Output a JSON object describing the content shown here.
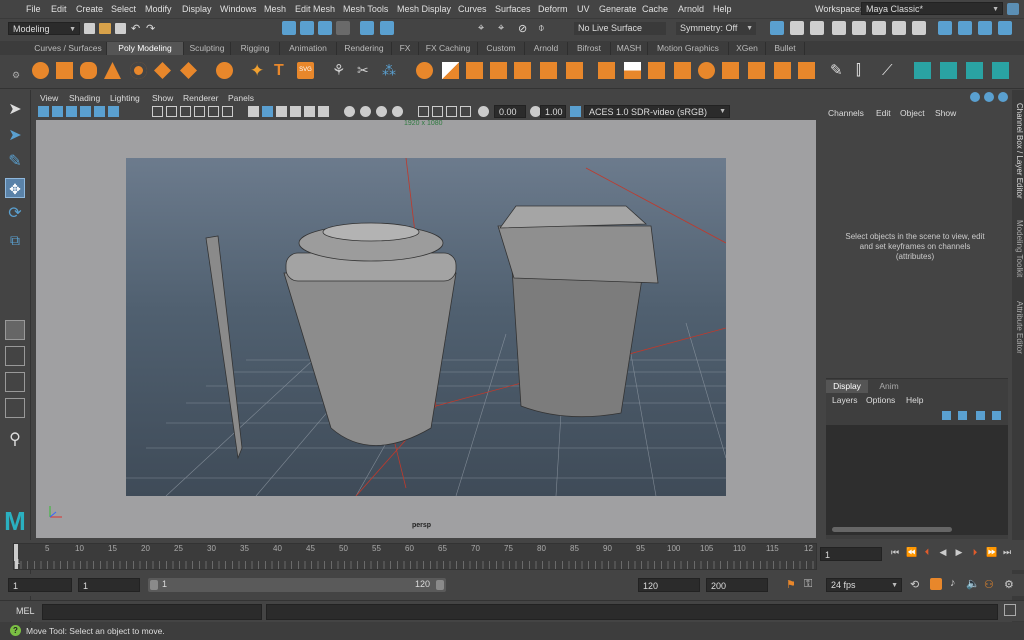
{
  "menubar": {
    "items": [
      "File",
      "Edit",
      "Create",
      "Select",
      "Modify",
      "Display",
      "Windows",
      "Mesh",
      "Edit Mesh",
      "Mesh Tools",
      "Mesh Display",
      "Curves",
      "Surfaces",
      "Deform",
      "UV",
      "Generate",
      "Cache",
      "Arnold",
      "Help"
    ],
    "workspace_label": "Workspace:",
    "workspace_value": "Maya Classic*"
  },
  "statusline": {
    "mode": "Modeling",
    "live_surface": "No Live Surface",
    "symmetry": "Symmetry: Off"
  },
  "shelf_tabs": [
    "Curves / Surfaces",
    "Poly Modeling",
    "Sculpting",
    "Rigging",
    "Animation",
    "Rendering",
    "FX",
    "FX Caching",
    "Custom",
    "Arnold",
    "Bifrost",
    "MASH",
    "Motion Graphics",
    "XGen",
    "Bullet"
  ],
  "shelf_active": "Poly Modeling",
  "viewport": {
    "menus": [
      "View",
      "Shading",
      "Lighting",
      "Show",
      "Renderer",
      "Panels"
    ],
    "near_value": "0.00",
    "far_value": "1.00",
    "color_space": "ACES 1.0 SDR-video (sRGB)",
    "resolution": "1920 x 1080",
    "camera": "persp"
  },
  "channel_box": {
    "menus": [
      "Channels",
      "Edit",
      "Object",
      "Show"
    ],
    "hint": "Select objects in the scene to view, edit and set keyframes on channels (attributes)"
  },
  "side_tabs": [
    "Channel Box / Layer Editor",
    "Modeling Toolkit",
    "Attribute Editor"
  ],
  "layer_editor": {
    "tabs": [
      "Display",
      "Anim"
    ],
    "menus": [
      "Layers",
      "Options",
      "Help"
    ]
  },
  "timeline": {
    "ticks": [
      "5",
      "10",
      "15",
      "20",
      "25",
      "30",
      "35",
      "40",
      "45",
      "50",
      "55",
      "60",
      "65",
      "70",
      "75",
      "80",
      "85",
      "90",
      "95",
      "100",
      "105",
      "110",
      "115",
      "12"
    ],
    "current_frame": "1",
    "current_marker": "1"
  },
  "range": {
    "start": "1",
    "anim_start": "1",
    "slider_start": "1",
    "slider_end": "120",
    "end": "120",
    "anim_end": "200",
    "fps": "24 fps"
  },
  "mel": {
    "label": "MEL"
  },
  "helpline": {
    "text": "Move Tool: Select an object to move."
  }
}
